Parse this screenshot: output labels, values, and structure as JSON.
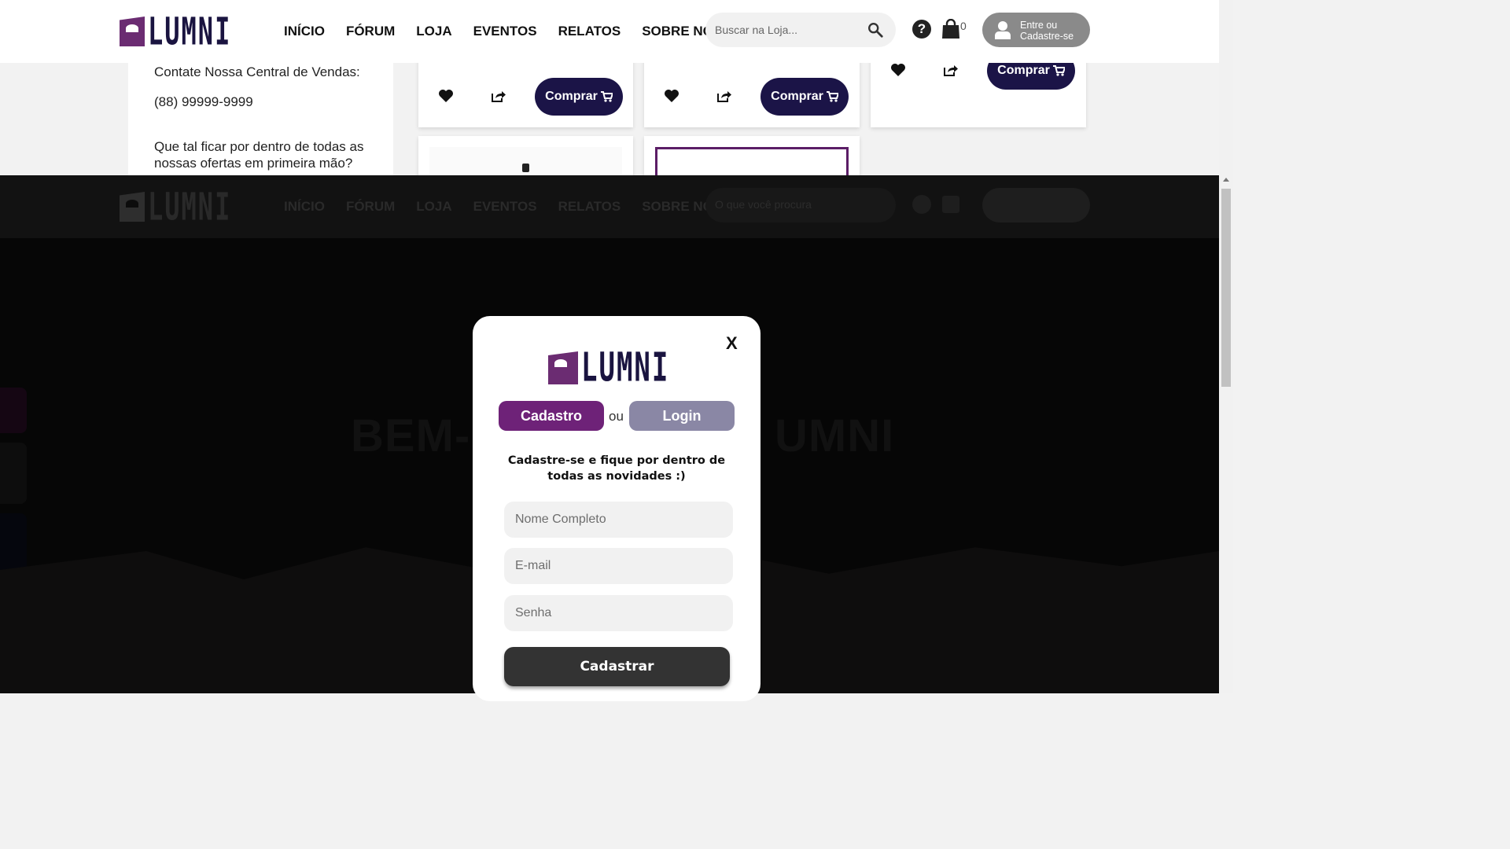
{
  "header": {
    "logo_text": "LUMNI",
    "nav": [
      "INÍCIO",
      "FÓRUM",
      "LOJA",
      "EVENTOS",
      "RELATOS",
      "SOBRE NÓS"
    ],
    "search_placeholder": "Buscar na Loja...",
    "help_icon_glyph": "?",
    "cart_count": "0",
    "login_line1": "Entre ou",
    "login_line2": "Cadastre-se"
  },
  "contact": {
    "title": "Contate Nossa Central de Vendas:",
    "phone": "(88) 99999-9999",
    "newsletter_line1": "Que tal ficar por dentro de todas as",
    "newsletter_line2": "nossas ofertas em primeira mão?"
  },
  "product_buy_label": "Comprar",
  "background": {
    "search_placeholder": "O que você procura"
  },
  "modal": {
    "close_label": "X",
    "logo_text": "LUMNI",
    "tab_register": "Cadastro",
    "separator": "ou",
    "tab_login": "Login",
    "description": "Cadastre-se e fique por dentro de todas as novidades :)",
    "name_placeholder": "Nome Completo",
    "email_placeholder": "E-mail",
    "password_placeholder": "Senha",
    "submit_label": "Cadastrar"
  },
  "colors": {
    "brand_purple": "#6e2278",
    "navy": "#1b1447",
    "login_tab": "#8a87a5",
    "submit": "#333333"
  }
}
